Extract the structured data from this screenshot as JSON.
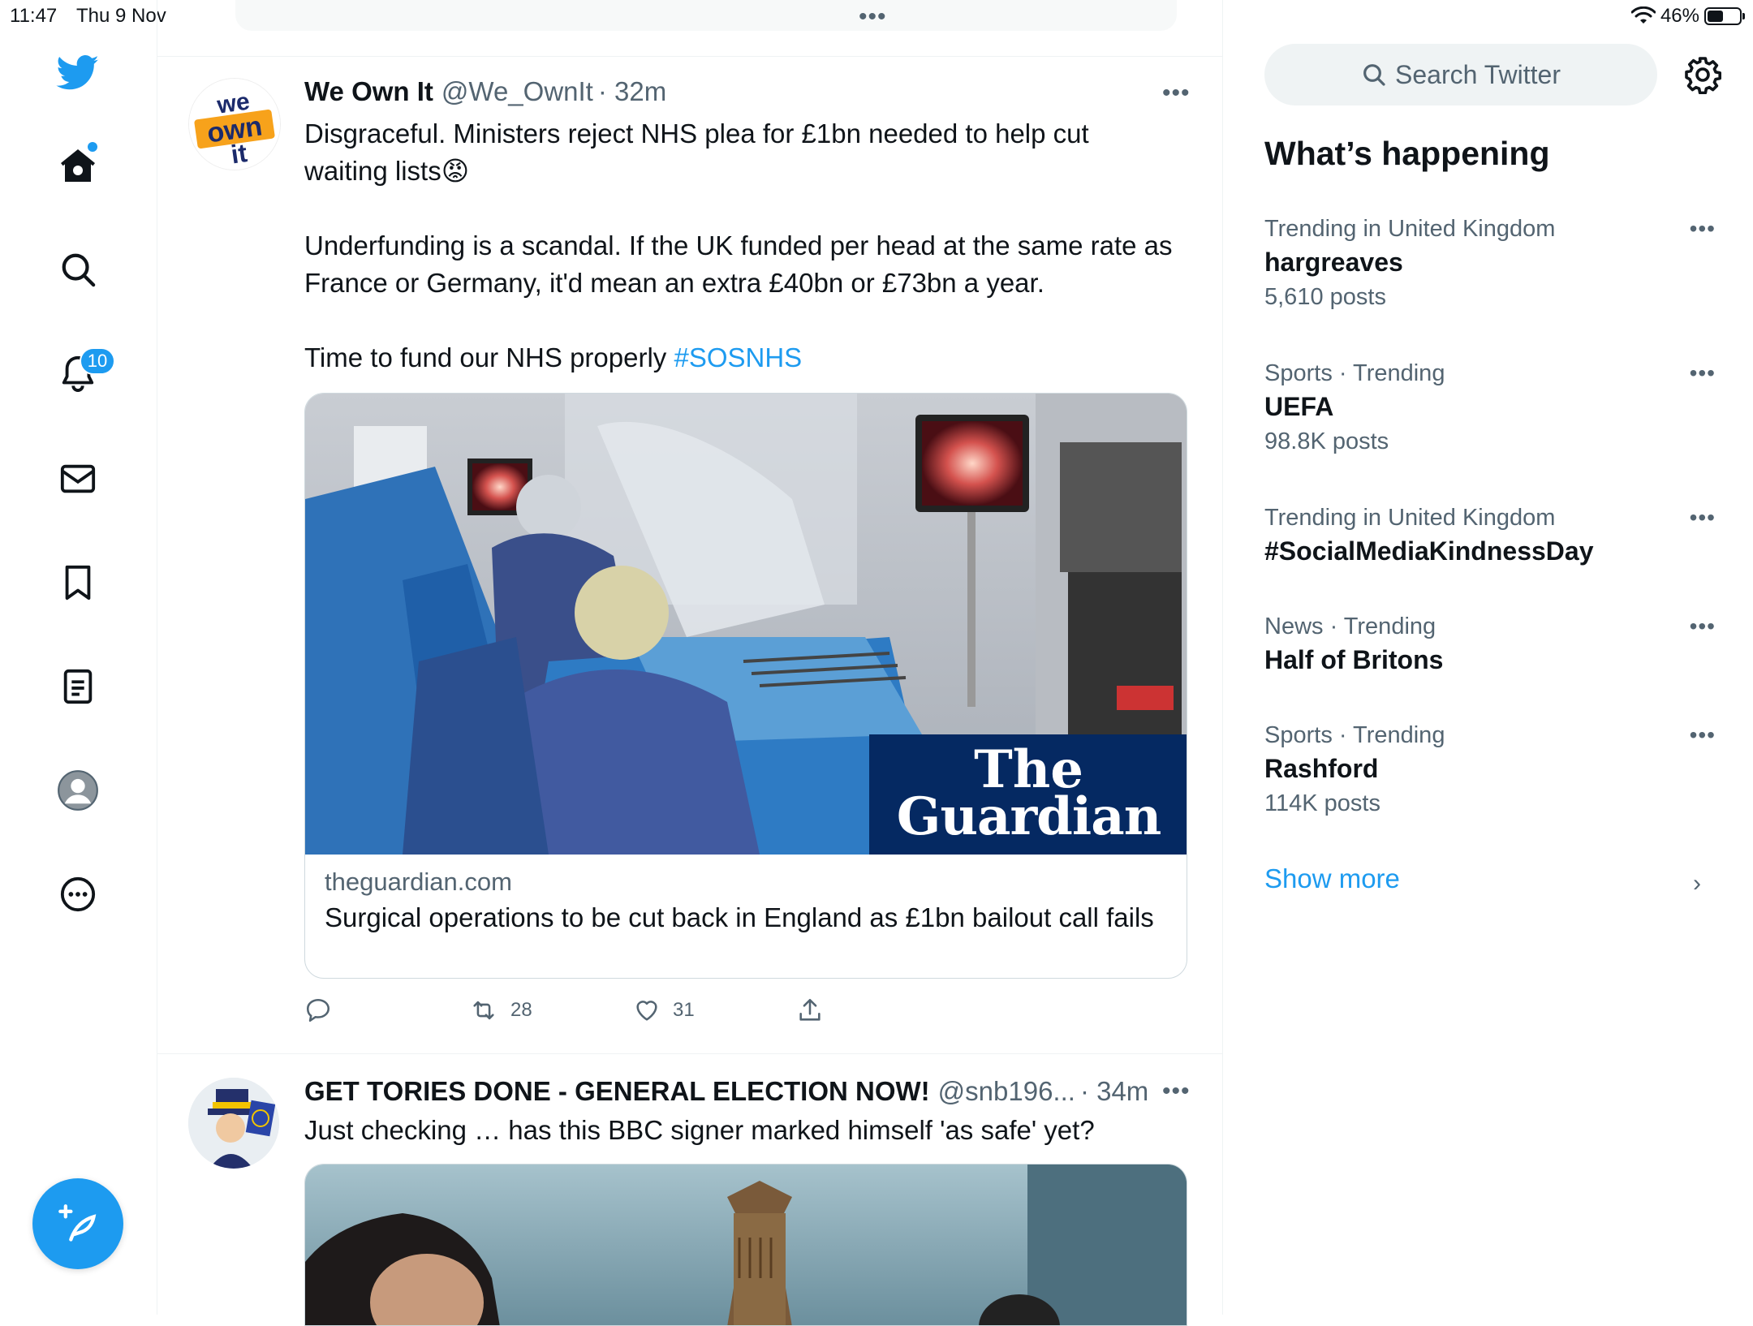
{
  "status_bar": {
    "time": "11:47",
    "date": "Thu 9 Nov",
    "battery": "46%",
    "battery_level": 0.46
  },
  "top_handle": "•••",
  "nav": {
    "items": [
      "twitter-logo",
      "home",
      "search",
      "notifications",
      "messages",
      "bookmarks",
      "lists",
      "profile",
      "more"
    ],
    "notifications_badge": "10"
  },
  "tweets": [
    {
      "name": "We Own It",
      "handle": "@We_OwnIt",
      "time": "· 32m",
      "more": "•••",
      "text_line1": "Disgraceful. Ministers reject NHS plea for £1bn needed to help cut",
      "text_line2": "waiting lists",
      "emoji": "😡",
      "para2": "Underfunding is a scandal. If the UK funded per head at the same rate as France or Germany, it'd mean an extra £40bn or £73bn a year.",
      "para3": "Time to fund our NHS properly ",
      "hashtag": "#SOSNHS",
      "card": {
        "logo_line1": "The",
        "logo_line2": "Guardian",
        "domain": "theguardian.com",
        "title": "Surgical operations to be cut back in England as £1bn bailout call fails"
      },
      "actions": {
        "reply": "",
        "retweets": "28",
        "likes": "31"
      }
    },
    {
      "name": "GET TORIES DONE - GENERAL ELECTION NOW!",
      "handle": "@snb196...",
      "time": "· 34m",
      "more": "•••",
      "text": "Just checking … has this BBC signer marked himself 'as safe' yet?"
    }
  ],
  "sidebar": {
    "search_placeholder": "Search Twitter",
    "heading": "What’s happening",
    "trends": [
      {
        "category": "Trending in United Kingdom",
        "name": "hargreaves",
        "count": "5,610 posts"
      },
      {
        "category": "Sports · Trending",
        "name": "UEFA",
        "count": "98.8K posts"
      },
      {
        "category": "Trending in United Kingdom",
        "name": "#SocialMediaKindnessDay",
        "count": ""
      },
      {
        "category": "News · Trending",
        "name": "Half of Britons",
        "count": ""
      },
      {
        "category": "Sports · Trending",
        "name": "Rashford",
        "count": "114K posts"
      }
    ],
    "trend_more": "•••",
    "show_more": "Show more",
    "chevron": "›"
  },
  "colors": {
    "accent": "#1d9bf0",
    "text": "#0f1419",
    "secondary": "#536471",
    "guardian_blue": "#052962"
  }
}
